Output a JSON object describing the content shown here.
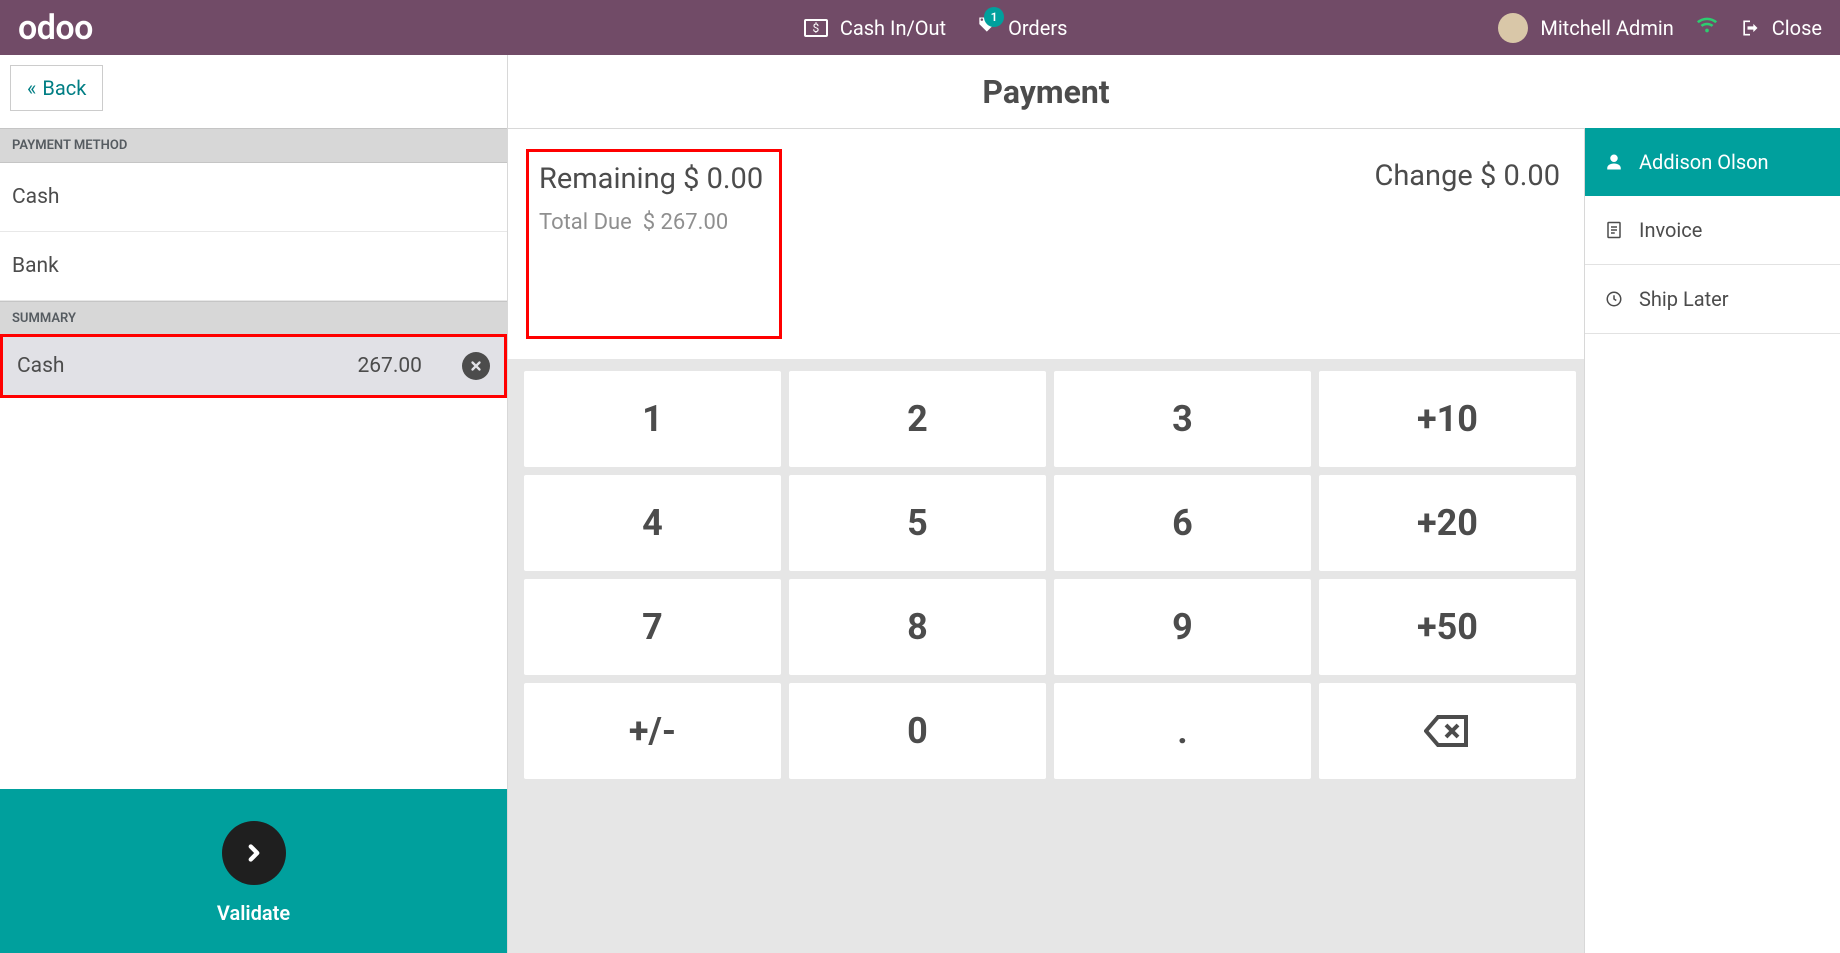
{
  "topbar": {
    "logo": "odoo",
    "cash_label": "Cash In/Out",
    "orders_label": "Orders",
    "orders_badge": "1",
    "user_name": "Mitchell Admin",
    "close_label": "Close"
  },
  "back_label": "Back",
  "payment_title": "Payment",
  "left": {
    "payment_method_header": "PAYMENT METHOD",
    "methods": [
      "Cash",
      "Bank"
    ],
    "summary_header": "SUMMARY",
    "summary": {
      "method": "Cash",
      "amount": "267.00"
    },
    "validate_label": "Validate"
  },
  "center": {
    "remaining_label": "Remaining",
    "remaining_value": "$ 0.00",
    "total_due_label": "Total Due",
    "total_due_value": "$ 267.00",
    "change_label": "Change",
    "change_value": "$ 0.00",
    "keys": [
      "1",
      "2",
      "3",
      "+10",
      "4",
      "5",
      "6",
      "+20",
      "7",
      "8",
      "9",
      "+50",
      "+/-",
      "0",
      ".",
      "⌫"
    ]
  },
  "right": {
    "customer_name": "Addison Olson",
    "invoice_label": "Invoice",
    "ship_later_label": "Ship Later"
  }
}
